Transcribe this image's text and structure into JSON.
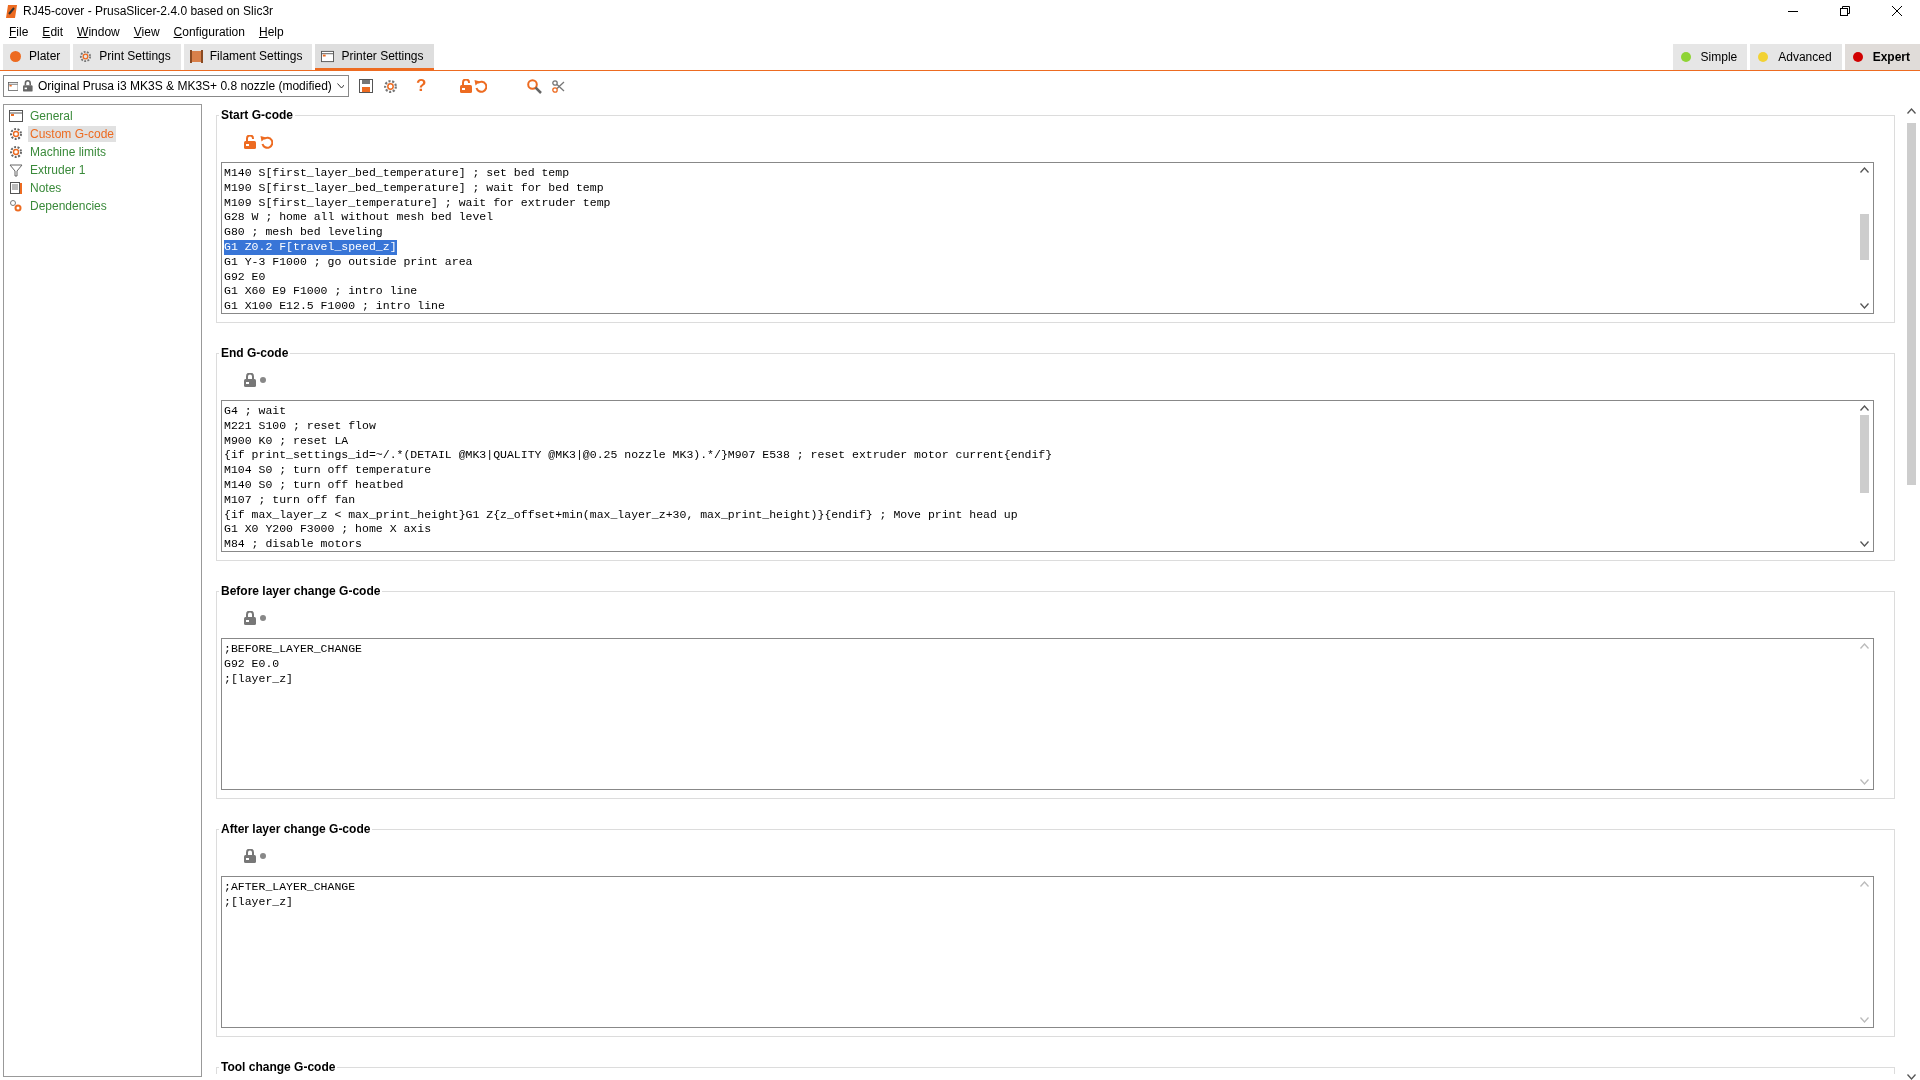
{
  "window": {
    "title": "RJ45-cover - PrusaSlicer-2.4.0 based on Slic3r"
  },
  "menu": [
    "File",
    "Edit",
    "Window",
    "View",
    "Configuration",
    "Help"
  ],
  "tabs": [
    {
      "label": "Plater",
      "selected": false
    },
    {
      "label": "Print Settings",
      "selected": false
    },
    {
      "label": "Filament Settings",
      "selected": false
    },
    {
      "label": "Printer Settings",
      "selected": true
    }
  ],
  "modes": [
    {
      "label": "Simple",
      "color": "#8fd435",
      "selected": false
    },
    {
      "label": "Advanced",
      "color": "#f2d234",
      "selected": false
    },
    {
      "label": "Expert",
      "color": "#d10000",
      "selected": true
    }
  ],
  "toolbar": {
    "preset": "Original Prusa i3 MK3S & MK3S+ 0.8 nozzle (modified)",
    "help_glyph": "?"
  },
  "sidebar": {
    "items": [
      {
        "label": "General",
        "kind": "page",
        "selected": false
      },
      {
        "label": "Custom G-code",
        "kind": "gear",
        "selected": true
      },
      {
        "label": "Machine limits",
        "kind": "gear",
        "selected": false
      },
      {
        "label": "Extruder 1",
        "kind": "extruder",
        "selected": false
      },
      {
        "label": "Notes",
        "kind": "notes",
        "selected": false
      },
      {
        "label": "Dependencies",
        "kind": "dependencies",
        "selected": false
      }
    ]
  },
  "sections": [
    {
      "title": "Start G-code",
      "modified": true,
      "scrollable": true,
      "lines": [
        {
          "text": "M140 S[first_layer_bed_temperature] ; set bed temp",
          "selected": false
        },
        {
          "text": "M190 S[first_layer_bed_temperature] ; wait for bed temp",
          "selected": false
        },
        {
          "text": "M109 S[first_layer_temperature] ; wait for extruder temp",
          "selected": false
        },
        {
          "text": "G28 W ; home all without mesh bed level",
          "selected": false
        },
        {
          "text": "G80 ; mesh bed leveling",
          "selected": false
        },
        {
          "text": "G1 Z0.2 F[travel_speed_z]",
          "selected": true
        },
        {
          "text": "G1 Y-3 F1000 ; go outside print area",
          "selected": false
        },
        {
          "text": "G92 E0",
          "selected": false
        },
        {
          "text": "G1 X60 E9 F1000 ; intro line",
          "selected": false
        },
        {
          "text": "G1 X100 E12.5 F1000 ; intro line",
          "selected": false
        }
      ]
    },
    {
      "title": "End G-code",
      "modified": false,
      "scrollable": true,
      "lines": [
        {
          "text": "G4 ; wait",
          "selected": false
        },
        {
          "text": "M221 S100 ; reset flow",
          "selected": false
        },
        {
          "text": "M900 K0 ; reset LA",
          "selected": false
        },
        {
          "text": "{if print_settings_id=~/.*(DETAIL @MK3|QUALITY @MK3|@0.25 nozzle MK3).*/}M907 E538 ; reset extruder motor current{endif}",
          "selected": false
        },
        {
          "text": "M104 S0 ; turn off temperature",
          "selected": false
        },
        {
          "text": "M140 S0 ; turn off heatbed",
          "selected": false
        },
        {
          "text": "M107 ; turn off fan",
          "selected": false
        },
        {
          "text": "{if max_layer_z < max_print_height}G1 Z{z_offset+min(max_layer_z+30, max_print_height)}{endif} ; Move print head up",
          "selected": false
        },
        {
          "text": "G1 X0 Y200 F3000 ; home X axis",
          "selected": false
        },
        {
          "text": "M84 ; disable motors",
          "selected": false
        }
      ]
    },
    {
      "title": "Before layer change G-code",
      "modified": false,
      "scrollable": false,
      "lines": [
        {
          "text": ";BEFORE_LAYER_CHANGE",
          "selected": false
        },
        {
          "text": "G92 E0.0",
          "selected": false
        },
        {
          "text": ";[layer_z]",
          "selected": false
        }
      ]
    },
    {
      "title": "After layer change G-code",
      "modified": false,
      "scrollable": false,
      "lines": [
        {
          "text": ";AFTER_LAYER_CHANGE",
          "selected": false
        },
        {
          "text": ";[layer_z]",
          "selected": false
        }
      ]
    },
    {
      "title": "Tool change G-code",
      "collapsed": true
    }
  ]
}
